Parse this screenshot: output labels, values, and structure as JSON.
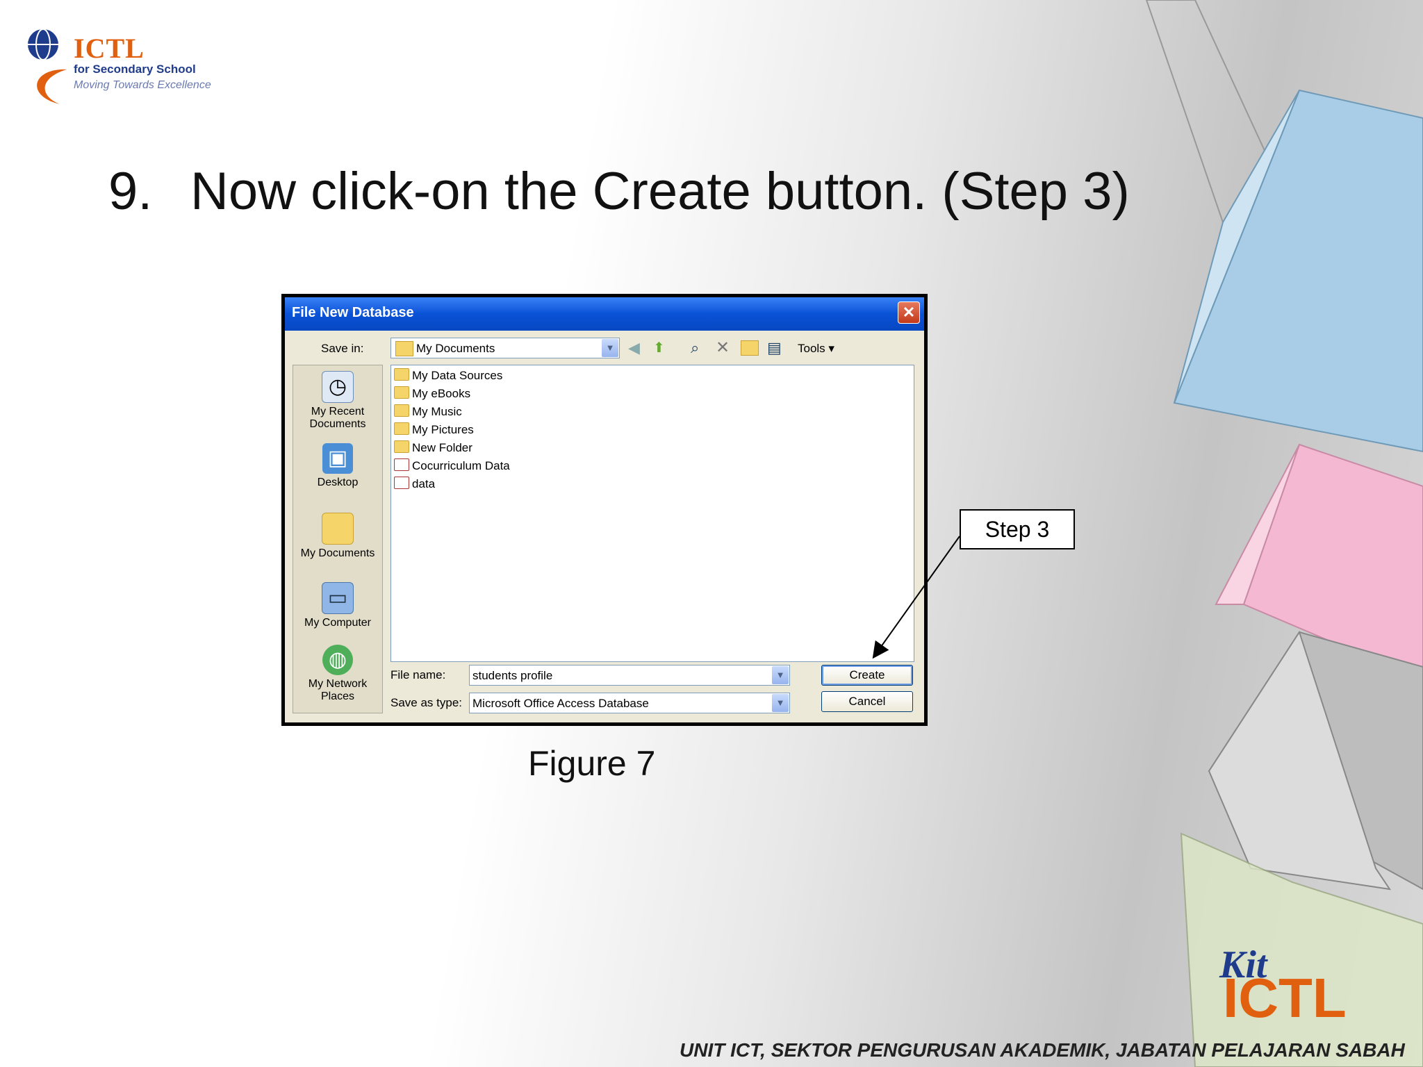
{
  "logo": {
    "name": "ICTL",
    "line1": "for Secondary School",
    "line2": "Moving Towards Excellence"
  },
  "slide": {
    "number": "9.",
    "title": "Now click-on the Create button. (Step 3)",
    "figure_caption": "Figure 7",
    "callout": "Step 3"
  },
  "dialog": {
    "title": "File New Database",
    "save_in_label": "Save in:",
    "save_in_value": "My Documents",
    "tools_label": "Tools",
    "places": [
      {
        "label": "My Recent Documents",
        "icon": "recent-documents-icon"
      },
      {
        "label": "Desktop",
        "icon": "desktop-icon"
      },
      {
        "label": "My Documents",
        "icon": "my-documents-icon"
      },
      {
        "label": "My Computer",
        "icon": "my-computer-icon"
      },
      {
        "label": "My Network Places",
        "icon": "network-places-icon"
      }
    ],
    "files": [
      {
        "name": "My Data Sources",
        "type": "folder"
      },
      {
        "name": "My eBooks",
        "type": "folder"
      },
      {
        "name": "My Music",
        "type": "folder"
      },
      {
        "name": "My Pictures",
        "type": "folder"
      },
      {
        "name": "New Folder",
        "type": "folder"
      },
      {
        "name": "Cocurriculum Data",
        "type": "database"
      },
      {
        "name": "data",
        "type": "database"
      }
    ],
    "file_name_label": "File name:",
    "file_name_value": "students profile",
    "save_type_label": "Save as type:",
    "save_type_value": "Microsoft Office Access Database",
    "create_label": "Create",
    "cancel_label": "Cancel"
  },
  "footer": {
    "text": "UNIT ICT, SEKTOR PENGURUSAN AKADEMIK, JABATAN PELAJARAN SABAH",
    "kit_logo": "Kit ICTL"
  },
  "colors": {
    "titlebar": "#0a52d6",
    "dialog_bg": "#ece9d8",
    "accent_orange": "#e06010",
    "logo_blue": "#1f3b8c"
  }
}
